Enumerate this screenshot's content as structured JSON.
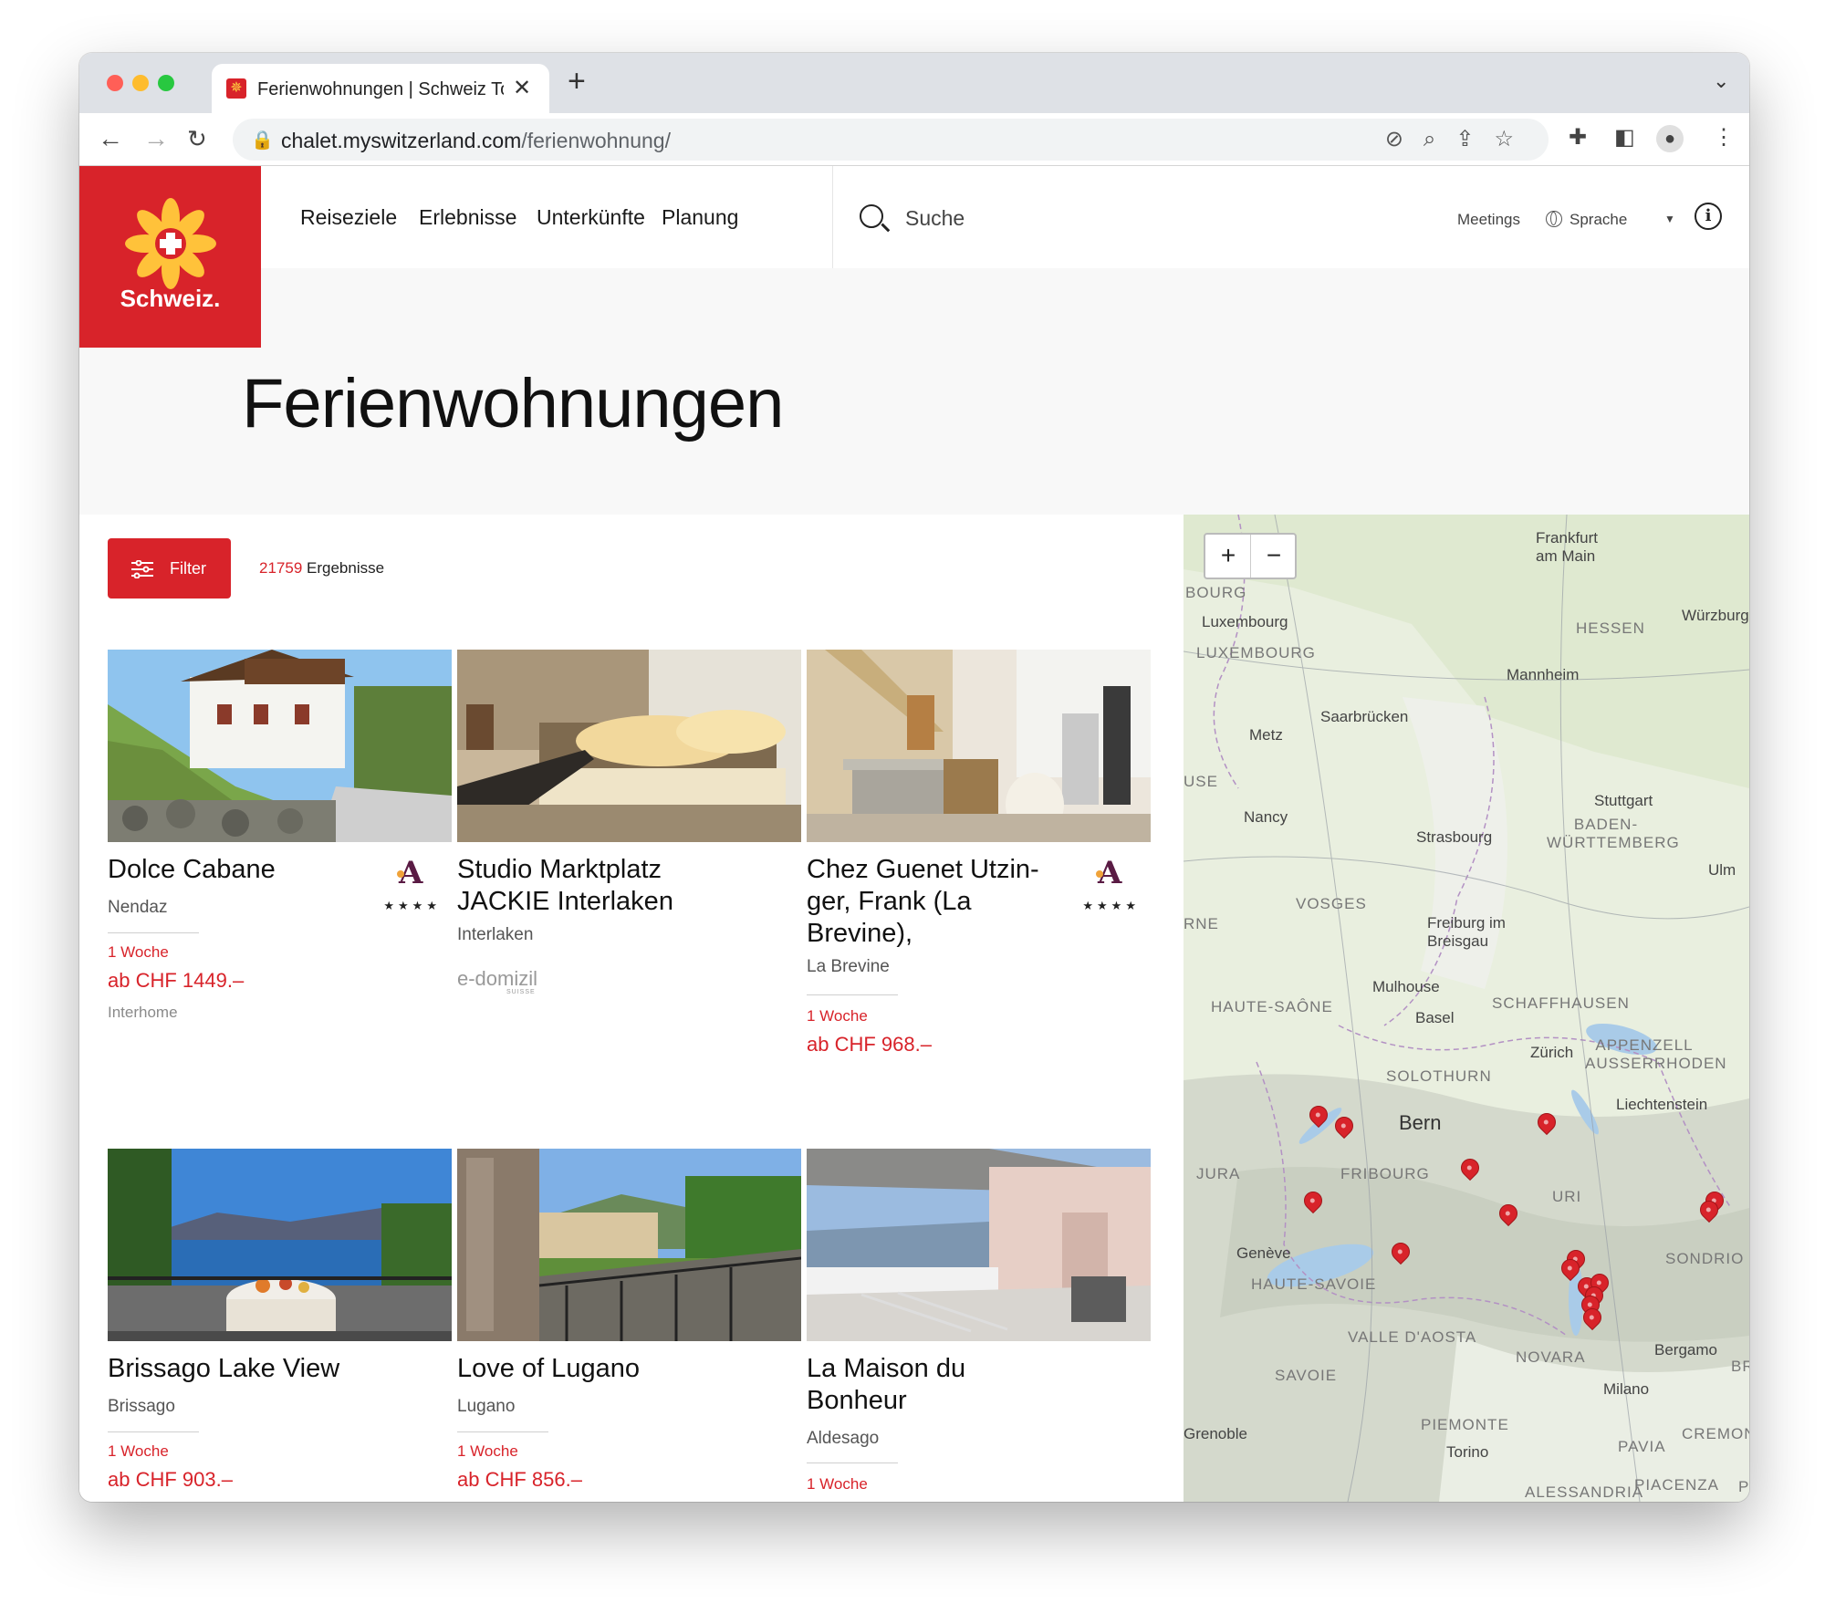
{
  "browser": {
    "tab_title": "Ferienwohnungen | Schweiz To",
    "url_host": "chalet.myswitzerland.com",
    "url_path": "/ferienwohnung/",
    "traffic_lights": {
      "close": "#ff5f57",
      "minimize": "#febc2e",
      "maximize": "#28c840"
    }
  },
  "site": {
    "logo_text": "Schweiz.",
    "brand_color": "#d8232a",
    "menu": [
      "Reiseziele",
      "Erlebnisse",
      "Unterkünfte",
      "Planung"
    ],
    "search_label": "Suche",
    "meetings": "Meetings",
    "language": "Sprache"
  },
  "page": {
    "title": "Ferienwohnungen",
    "filter_label": "Filter",
    "results_count": "21759",
    "results_label": "Ergebnisse"
  },
  "listings": [
    {
      "title": "Dolce Cabane",
      "location": "Nendaz",
      "duration": "1 Woche",
      "price": "ab CHF 1449.–",
      "provider": "Interhome",
      "badge": "A",
      "stars": "★★★★"
    },
    {
      "title": "Studio Marktplatz JACKIE Interlaken",
      "location": "Interlaken",
      "duration": "",
      "price": "",
      "provider": "e-domizil",
      "provider_sub": "SUISSE",
      "badge": "",
      "stars": ""
    },
    {
      "title": "Chez Guenet Utzin-ger, Frank (La Brevine),",
      "location": "La Brevine",
      "duration": "1 Woche",
      "price": "ab CHF 968.–",
      "provider": "",
      "badge": "A",
      "stars": "★★★★"
    },
    {
      "title": "Brissago Lake View",
      "location": "Brissago",
      "duration": "1 Woche",
      "price": "ab CHF 903.–",
      "provider": "",
      "badge": "",
      "stars": ""
    },
    {
      "title": "Love of Lugano",
      "location": "Lugano",
      "duration": "1 Woche",
      "price": "ab CHF 856.–",
      "provider": "",
      "badge": "",
      "stars": ""
    },
    {
      "title": "La Maison du Bonheur",
      "location": "Aldesago",
      "duration": "1 Woche",
      "price": "",
      "provider": "",
      "badge": "",
      "stars": ""
    }
  ],
  "map": {
    "zoom_in": "+",
    "zoom_out": "−",
    "cities": [
      "Frankfurt am Main",
      "Luxembourg",
      "Mannheim",
      "Würzburg",
      "Saarbrücken",
      "Metz",
      "Nancy",
      "Stuttgart",
      "Strasbourg",
      "Ulm",
      "Freiburg im Breisgau",
      "Mulhouse",
      "Basel",
      "Zürich",
      "Bern",
      "Liechtenstein",
      "Genève",
      "Milano",
      "Bergamo",
      "Torino",
      "Grenoble"
    ],
    "regions": [
      "BOURG",
      "LUXEMBOURG",
      "HESSEN",
      "USE",
      "BADEN-WÜRTTEMBERG",
      "VOSGES",
      "RNE",
      "HAUTE-SAÔNE",
      "SCHAFFHAUSEN",
      "SOLOTHURN",
      "APPENZELL AUSSERRHODEN",
      "JURA",
      "FRIBOURG",
      "URI",
      "SONDRIO",
      "HAUTE-SAVOIE",
      "VALLE D'AOSTA",
      "NOVARA",
      "SAVOIE",
      "PIEMONTE",
      "PAVIA",
      "CREMON",
      "ALESSANDRIA",
      "PIACENZA",
      "BR",
      "P"
    ],
    "marker_count": 16
  }
}
